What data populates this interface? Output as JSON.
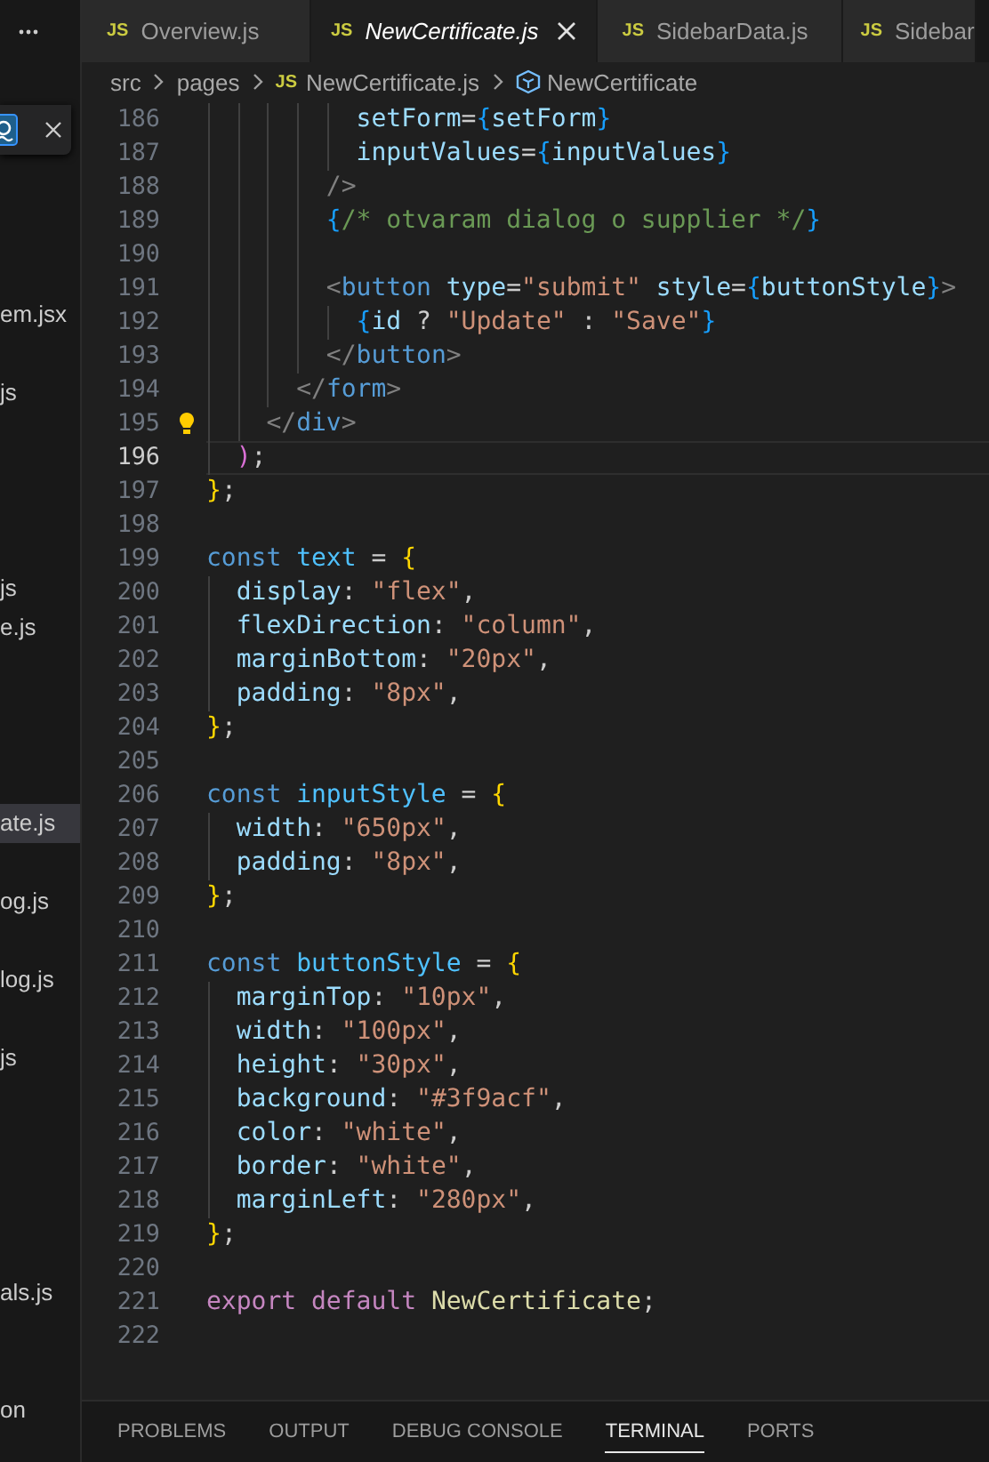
{
  "tabs": [
    {
      "badge": "JS",
      "label": "Overview.js",
      "selected": false
    },
    {
      "badge": "JS",
      "label": "NewCertificate.js",
      "selected": true
    },
    {
      "badge": "JS",
      "label": "SidebarData.js",
      "selected": false
    },
    {
      "badge": "JS",
      "label": "Sidebar",
      "selected": false
    }
  ],
  "breadcrumb": [
    {
      "kind": "folder",
      "label": "src"
    },
    {
      "kind": "folder",
      "label": "pages"
    },
    {
      "kind": "file",
      "badge": "JS",
      "label": "NewCertificate.js"
    },
    {
      "kind": "symbol",
      "label": "NewCertificate"
    }
  ],
  "sidebar": {
    "items": [
      {
        "label": "em.jsx",
        "selected": false
      },
      {
        "label": "js",
        "selected": false
      },
      {
        "label": "js",
        "selected": false
      },
      {
        "label": "e.js",
        "selected": false
      },
      {
        "label": "ate.js",
        "selected": true
      },
      {
        "label": "og.js",
        "selected": false
      },
      {
        "label": "log.js",
        "selected": false
      },
      {
        "label": "js",
        "selected": false
      },
      {
        "label": "als.js",
        "selected": false
      },
      {
        "label": "on",
        "selected": false
      }
    ]
  },
  "editor": {
    "lines": [
      {
        "number": "186",
        "current": false,
        "hint": false,
        "segments": [
          {
            "kind": "attr",
            "text": "          setForm"
          },
          {
            "kind": "plain",
            "text": "="
          },
          {
            "kind": "brace3",
            "text": "{"
          },
          {
            "kind": "attr",
            "text": "setForm"
          },
          {
            "kind": "brace3",
            "text": "}"
          }
        ]
      },
      {
        "number": "187",
        "current": false,
        "hint": false,
        "segments": [
          {
            "kind": "attr",
            "text": "          inputValues"
          },
          {
            "kind": "plain",
            "text": "="
          },
          {
            "kind": "brace3",
            "text": "{"
          },
          {
            "kind": "attr",
            "text": "inputValues"
          },
          {
            "kind": "brace3",
            "text": "}"
          }
        ]
      },
      {
        "number": "188",
        "current": false,
        "hint": false,
        "segments": [
          {
            "kind": "angle",
            "text": "        />"
          }
        ]
      },
      {
        "number": "189",
        "current": false,
        "hint": false,
        "segments": [
          {
            "kind": "brace3",
            "text": "        {"
          },
          {
            "kind": "comment",
            "text": "/* otvaram dialog o supplier */"
          },
          {
            "kind": "brace3",
            "text": "}"
          }
        ]
      },
      {
        "number": "190",
        "current": false,
        "hint": false
      },
      {
        "number": "191",
        "current": false,
        "hint": false,
        "segments": [
          {
            "kind": "angle",
            "text": "        <"
          },
          {
            "kind": "tag",
            "text": "button "
          },
          {
            "kind": "attr",
            "text": "type"
          },
          {
            "kind": "plain",
            "text": "="
          },
          {
            "kind": "string",
            "text": "\"submit\" "
          },
          {
            "kind": "attr",
            "text": "style"
          },
          {
            "kind": "plain",
            "text": "="
          },
          {
            "kind": "brace3",
            "text": "{"
          },
          {
            "kind": "attr",
            "text": "buttonStyle"
          },
          {
            "kind": "brace3",
            "text": "}"
          },
          {
            "kind": "angle",
            "text": ">"
          }
        ]
      },
      {
        "number": "192",
        "current": false,
        "hint": false,
        "segments": [
          {
            "kind": "brace3",
            "text": "          {"
          },
          {
            "kind": "attr",
            "text": "id"
          },
          {
            "kind": "plain",
            "text": " ? "
          },
          {
            "kind": "string",
            "text": "\"Update\""
          },
          {
            "kind": "plain",
            "text": " : "
          },
          {
            "kind": "string",
            "text": "\"Save\""
          },
          {
            "kind": "brace3",
            "text": "}"
          }
        ]
      },
      {
        "number": "193",
        "current": false,
        "hint": false,
        "segments": [
          {
            "kind": "angle",
            "text": "        </"
          },
          {
            "kind": "tag",
            "text": "button"
          },
          {
            "kind": "angle",
            "text": ">"
          }
        ]
      },
      {
        "number": "194",
        "current": false,
        "hint": false,
        "segments": [
          {
            "kind": "angle",
            "text": "      </"
          },
          {
            "kind": "tag",
            "text": "form"
          },
          {
            "kind": "angle",
            "text": ">"
          }
        ]
      },
      {
        "number": "195",
        "current": false,
        "hint": true,
        "segments": [
          {
            "kind": "angle",
            "text": "    </"
          },
          {
            "kind": "tag",
            "text": "div"
          },
          {
            "kind": "angle",
            "text": ">"
          }
        ]
      },
      {
        "number": "196",
        "current": true,
        "hint": false,
        "segments": [
          {
            "kind": "brace2",
            "text": "  )"
          },
          {
            "kind": "plain",
            "text": ";"
          }
        ]
      },
      {
        "number": "197",
        "current": false,
        "hint": false,
        "segments": [
          {
            "kind": "brace1",
            "text": "}"
          },
          {
            "kind": "plain",
            "text": ";"
          }
        ]
      },
      {
        "number": "198",
        "current": false,
        "hint": false
      },
      {
        "number": "199",
        "current": false,
        "hint": false,
        "segments": [
          {
            "kind": "keyword",
            "text": "const "
          },
          {
            "kind": "constant",
            "text": "text"
          },
          {
            "kind": "plain",
            "text": " = "
          },
          {
            "kind": "brace1",
            "text": "{"
          }
        ]
      },
      {
        "number": "200",
        "current": false,
        "hint": false,
        "segments": [
          {
            "kind": "attr",
            "text": "  display"
          },
          {
            "kind": "plain",
            "text": ": "
          },
          {
            "kind": "string",
            "text": "\"flex\""
          },
          {
            "kind": "plain",
            "text": ","
          }
        ]
      },
      {
        "number": "201",
        "current": false,
        "hint": false,
        "segments": [
          {
            "kind": "attr",
            "text": "  flexDirection"
          },
          {
            "kind": "plain",
            "text": ": "
          },
          {
            "kind": "string",
            "text": "\"column\""
          },
          {
            "kind": "plain",
            "text": ","
          }
        ]
      },
      {
        "number": "202",
        "current": false,
        "hint": false,
        "segments": [
          {
            "kind": "attr",
            "text": "  marginBottom"
          },
          {
            "kind": "plain",
            "text": ": "
          },
          {
            "kind": "string",
            "text": "\"20px\""
          },
          {
            "kind": "plain",
            "text": ","
          }
        ]
      },
      {
        "number": "203",
        "current": false,
        "hint": false,
        "segments": [
          {
            "kind": "attr",
            "text": "  padding"
          },
          {
            "kind": "plain",
            "text": ": "
          },
          {
            "kind": "string",
            "text": "\"8px\""
          },
          {
            "kind": "plain",
            "text": ","
          }
        ]
      },
      {
        "number": "204",
        "current": false,
        "hint": false,
        "segments": [
          {
            "kind": "brace1",
            "text": "}"
          },
          {
            "kind": "plain",
            "text": ";"
          }
        ]
      },
      {
        "number": "205",
        "current": false,
        "hint": false
      },
      {
        "number": "206",
        "current": false,
        "hint": false,
        "segments": [
          {
            "kind": "keyword",
            "text": "const "
          },
          {
            "kind": "constant",
            "text": "inputStyle"
          },
          {
            "kind": "plain",
            "text": " = "
          },
          {
            "kind": "brace1",
            "text": "{"
          }
        ]
      },
      {
        "number": "207",
        "current": false,
        "hint": false,
        "segments": [
          {
            "kind": "attr",
            "text": "  width"
          },
          {
            "kind": "plain",
            "text": ": "
          },
          {
            "kind": "string",
            "text": "\"650px\""
          },
          {
            "kind": "plain",
            "text": ","
          }
        ]
      },
      {
        "number": "208",
        "current": false,
        "hint": false,
        "segments": [
          {
            "kind": "attr",
            "text": "  padding"
          },
          {
            "kind": "plain",
            "text": ": "
          },
          {
            "kind": "string",
            "text": "\"8px\""
          },
          {
            "kind": "plain",
            "text": ","
          }
        ]
      },
      {
        "number": "209",
        "current": false,
        "hint": false,
        "segments": [
          {
            "kind": "brace1",
            "text": "}"
          },
          {
            "kind": "plain",
            "text": ";"
          }
        ]
      },
      {
        "number": "210",
        "current": false,
        "hint": false
      },
      {
        "number": "211",
        "current": false,
        "hint": false,
        "segments": [
          {
            "kind": "keyword",
            "text": "const "
          },
          {
            "kind": "constant",
            "text": "buttonStyle"
          },
          {
            "kind": "plain",
            "text": " = "
          },
          {
            "kind": "brace1",
            "text": "{"
          }
        ]
      },
      {
        "number": "212",
        "current": false,
        "hint": false,
        "segments": [
          {
            "kind": "attr",
            "text": "  marginTop"
          },
          {
            "kind": "plain",
            "text": ": "
          },
          {
            "kind": "string",
            "text": "\"10px\""
          },
          {
            "kind": "plain",
            "text": ","
          }
        ]
      },
      {
        "number": "213",
        "current": false,
        "hint": false,
        "segments": [
          {
            "kind": "attr",
            "text": "  width"
          },
          {
            "kind": "plain",
            "text": ": "
          },
          {
            "kind": "string",
            "text": "\"100px\""
          },
          {
            "kind": "plain",
            "text": ","
          }
        ]
      },
      {
        "number": "214",
        "current": false,
        "hint": false,
        "segments": [
          {
            "kind": "attr",
            "text": "  height"
          },
          {
            "kind": "plain",
            "text": ": "
          },
          {
            "kind": "string",
            "text": "\"30px\""
          },
          {
            "kind": "plain",
            "text": ","
          }
        ]
      },
      {
        "number": "215",
        "current": false,
        "hint": false,
        "segments": [
          {
            "kind": "attr",
            "text": "  background"
          },
          {
            "kind": "plain",
            "text": ": "
          },
          {
            "kind": "string",
            "text": "\"#3f9acf\""
          },
          {
            "kind": "plain",
            "text": ","
          }
        ]
      },
      {
        "number": "216",
        "current": false,
        "hint": false,
        "segments": [
          {
            "kind": "attr",
            "text": "  color"
          },
          {
            "kind": "plain",
            "text": ": "
          },
          {
            "kind": "string",
            "text": "\"white\""
          },
          {
            "kind": "plain",
            "text": ","
          }
        ]
      },
      {
        "number": "217",
        "current": false,
        "hint": false,
        "segments": [
          {
            "kind": "attr",
            "text": "  border"
          },
          {
            "kind": "plain",
            "text": ": "
          },
          {
            "kind": "string",
            "text": "\"white\""
          },
          {
            "kind": "plain",
            "text": ","
          }
        ]
      },
      {
        "number": "218",
        "current": false,
        "hint": false,
        "segments": [
          {
            "kind": "attr",
            "text": "  marginLeft"
          },
          {
            "kind": "plain",
            "text": ": "
          },
          {
            "kind": "string",
            "text": "\"280px\""
          },
          {
            "kind": "plain",
            "text": ","
          }
        ]
      },
      {
        "number": "219",
        "current": false,
        "hint": false,
        "segments": [
          {
            "kind": "brace1",
            "text": "}"
          },
          {
            "kind": "plain",
            "text": ";"
          }
        ]
      },
      {
        "number": "220",
        "current": false,
        "hint": false
      },
      {
        "number": "221",
        "current": false,
        "hint": false,
        "segments": [
          {
            "kind": "control",
            "text": "export default "
          },
          {
            "kind": "function",
            "text": "NewCertificate"
          },
          {
            "kind": "plain",
            "text": ";"
          }
        ]
      },
      {
        "number": "222",
        "current": false,
        "hint": false
      }
    ]
  },
  "panel": {
    "tabs": [
      {
        "label": "PROBLEMS",
        "selected": false
      },
      {
        "label": "OUTPUT",
        "selected": false
      },
      {
        "label": "DEBUG CONSOLE",
        "selected": false
      },
      {
        "label": "TERMINAL",
        "selected": true
      },
      {
        "label": "PORTS",
        "selected": false
      }
    ]
  }
}
